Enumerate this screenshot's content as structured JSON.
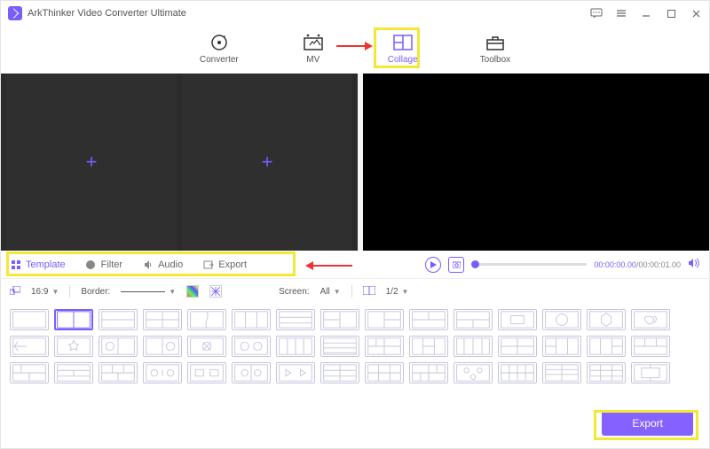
{
  "app": {
    "title": "ArkThinker Video Converter Ultimate"
  },
  "nav": {
    "converter": "Converter",
    "mv": "MV",
    "collage": "Collage",
    "toolbox": "Toolbox"
  },
  "subtabs": {
    "template": "Template",
    "filter": "Filter",
    "audio": "Audio",
    "export": "Export"
  },
  "preview": {
    "time_current": "00:00:00.00",
    "time_total": "00:00:01.00"
  },
  "options": {
    "ratio": "16:9",
    "border_label": "Border:",
    "screen_label": "Screen:",
    "screen_value": "All",
    "split": "1/2"
  },
  "footer": {
    "export": "Export"
  }
}
